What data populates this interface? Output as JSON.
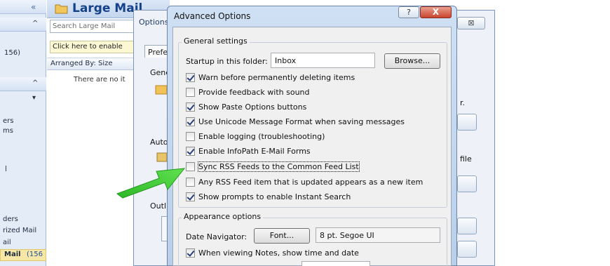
{
  "nav": {
    "items": [
      {
        "text": "«"
      },
      {
        "text": "^"
      },
      {
        "text": "156)"
      },
      {
        "text": "^"
      },
      {
        "text": "▾"
      },
      {
        "text": "ers"
      },
      {
        "text": "ms"
      },
      {
        "text": "ders"
      },
      {
        "text": "rized Mail"
      },
      {
        "text": "ail"
      },
      {
        "text": "Mail"
      },
      {
        "text": "(156"
      }
    ]
  },
  "folder": {
    "title": "Large Mail",
    "search_placeholder": "Search Large Mail",
    "click_bar": "Click here to enable",
    "arranged_by": "Arranged By: Size",
    "empty": "There are no it"
  },
  "options_dialog": {
    "title": "Options",
    "tab_partial": "Prefe",
    "labels": [
      "Gene",
      "Auto",
      "Outl"
    ],
    "right_texts": [
      "r.",
      "file"
    ]
  },
  "advanced": {
    "title": "Advanced Options",
    "help": "?",
    "close": "X",
    "general": {
      "legend": "General settings",
      "startup_label": "Startup in this folder:",
      "startup_value": "Inbox",
      "browse": "Browse...",
      "checkboxes": [
        {
          "label": "Warn before permanently deleting items",
          "checked": true
        },
        {
          "label": "Provide feedback with sound",
          "checked": false
        },
        {
          "label": "Show Paste Options buttons",
          "checked": true
        },
        {
          "label": "Use Unicode Message Format when saving messages",
          "checked": true
        },
        {
          "label": "Enable logging (troubleshooting)",
          "checked": false
        },
        {
          "label": "Enable InfoPath E-Mail Forms",
          "checked": true
        },
        {
          "label": "Sync RSS Feeds to the Common Feed List",
          "checked": false
        },
        {
          "label": "Any RSS Feed item that is updated appears as a new item",
          "checked": false
        },
        {
          "label": "Show prompts to enable Instant Search",
          "checked": true
        }
      ]
    },
    "appearance": {
      "legend": "Appearance options",
      "date_nav_label": "Date Navigator:",
      "font_button": "Font...",
      "font_value": "8 pt. Segoe UI",
      "notes_label": "When viewing Notes, show time and date"
    }
  },
  "colors": {
    "accent": "#15428b",
    "arrow": "#35c22e"
  }
}
